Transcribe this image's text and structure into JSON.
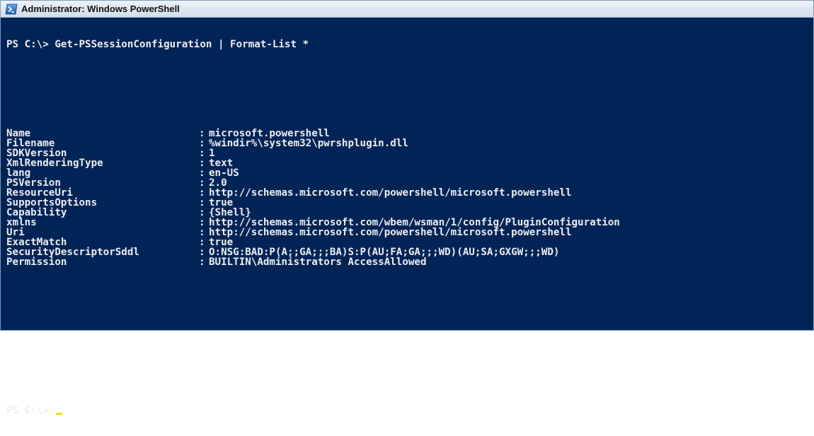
{
  "window": {
    "title": "Administrator: Windows PowerShell",
    "icon": "powershell-icon",
    "background_color": "#012456",
    "text_color": "#eeedf0"
  },
  "console": {
    "command_line": "PS C:\\> Get-PSSessionConfiguration | Format-List *",
    "properties": [
      {
        "name": "Name",
        "value": "microsoft.powershell"
      },
      {
        "name": "Filename",
        "value": "%windir%\\system32\\pwrshplugin.dll"
      },
      {
        "name": "SDKVersion",
        "value": "1"
      },
      {
        "name": "XmlRenderingType",
        "value": "text"
      },
      {
        "name": "lang",
        "value": "en-US"
      },
      {
        "name": "PSVersion",
        "value": "2.0"
      },
      {
        "name": "ResourceUri",
        "value": "http://schemas.microsoft.com/powershell/microsoft.powershell"
      },
      {
        "name": "SupportsOptions",
        "value": "true"
      },
      {
        "name": "Capability",
        "value": "{Shell}"
      },
      {
        "name": "xmlns",
        "value": "http://schemas.microsoft.com/wbem/wsman/1/config/PluginConfiguration"
      },
      {
        "name": "Uri",
        "value": "http://schemas.microsoft.com/powershell/microsoft.powershell"
      },
      {
        "name": "ExactMatch",
        "value": "true"
      },
      {
        "name": "SecurityDescriptorSddl",
        "value": "O:NSG:BAD:P(A;;GA;;;BA)S:P(AU;FA;GA;;;WD)(AU;SA;GXGW;;;WD)"
      },
      {
        "name": "Permission",
        "value": "BUILTIN\\Administrators AccessAllowed"
      }
    ],
    "separator": ":",
    "prompt": "PS C:\\>"
  }
}
